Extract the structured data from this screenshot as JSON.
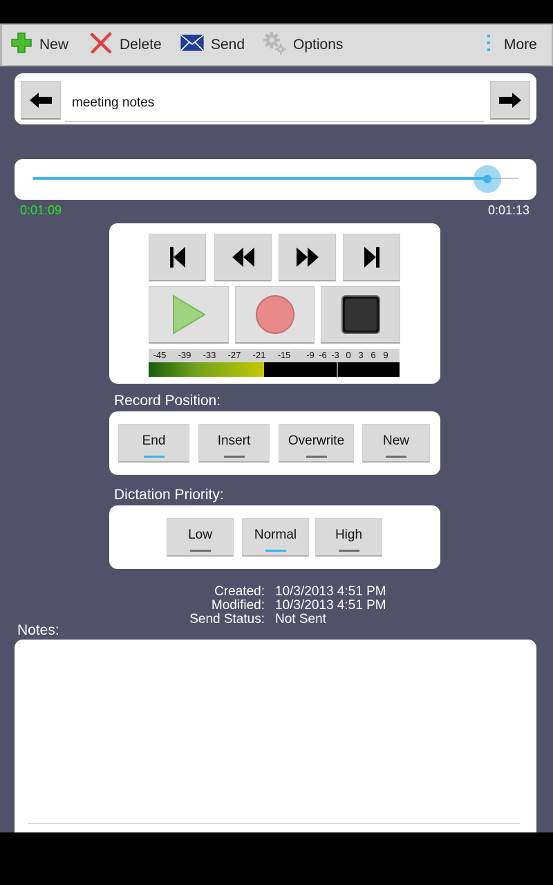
{
  "toolbar": {
    "new_label": "New",
    "delete_label": "Delete",
    "send_label": "Send",
    "options_label": "Options",
    "more_label": "More"
  },
  "recording": {
    "title": "meeting notes"
  },
  "playback": {
    "current_time": "0:01:09",
    "total_time": "0:01:13",
    "progress_fraction": 0.936
  },
  "transport": {
    "buttons": [
      "skip-to-start",
      "rewind",
      "fast-forward",
      "skip-to-end",
      "play",
      "record",
      "stop"
    ]
  },
  "level_meter": {
    "scale_labels": [
      "-45",
      "-39",
      "-33",
      "-27",
      "-21",
      "-15",
      "-9",
      "-6",
      "-3",
      "0",
      "3",
      "6",
      "9"
    ],
    "level_fraction": 0.46,
    "peak_fraction": 0.75
  },
  "record_position": {
    "label": "Record Position:",
    "options": [
      "End",
      "Insert",
      "Overwrite",
      "New"
    ],
    "selected": "End"
  },
  "dictation_priority": {
    "label": "Dictation Priority:",
    "options": [
      "Low",
      "Normal",
      "High"
    ],
    "selected": "Normal"
  },
  "meta": {
    "created_label": "Created:",
    "created_value": "10/3/2013 4:51 PM",
    "modified_label": "Modified:",
    "modified_value": "10/3/2013 4:51 PM",
    "send_status_label": "Send Status:",
    "send_status_value": "Not Sent"
  },
  "notes": {
    "label": "Notes:",
    "value": ""
  },
  "colors": {
    "background": "#51526a",
    "accent": "#3fb4e6",
    "current_time": "#22e622"
  }
}
